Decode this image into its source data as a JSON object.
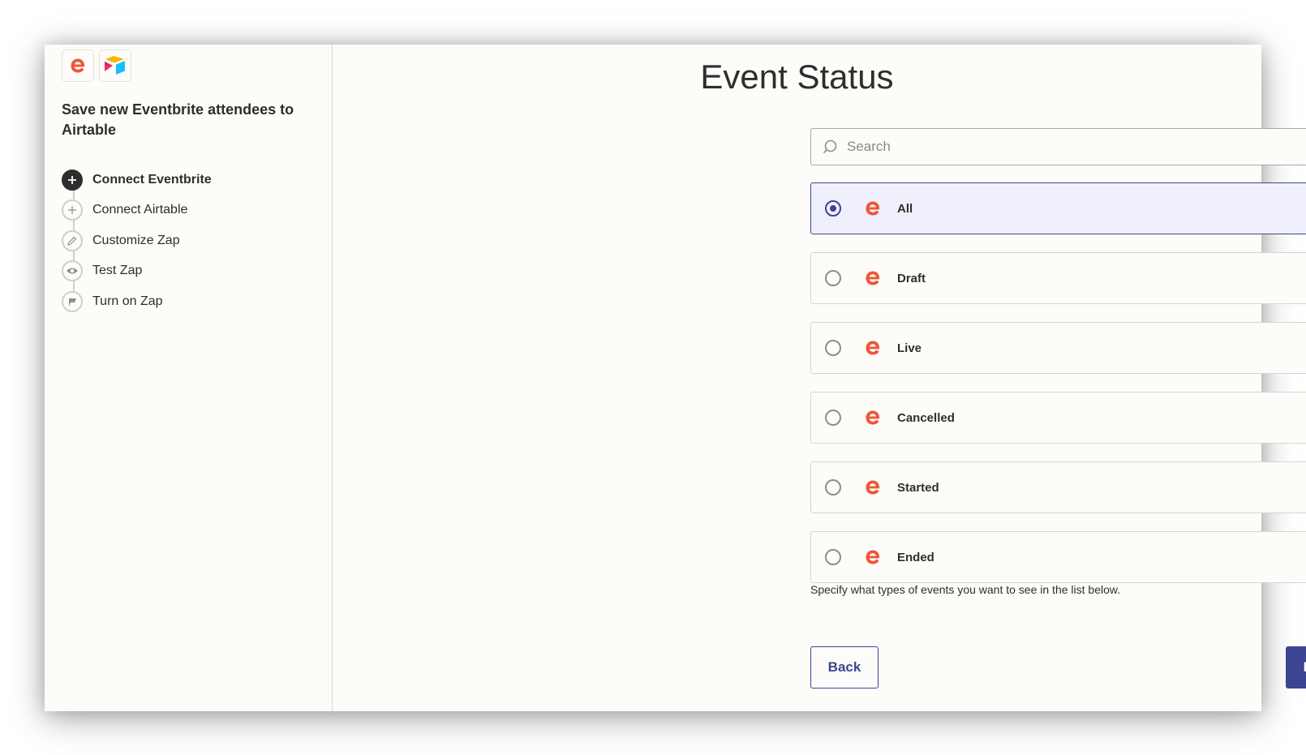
{
  "sidebar": {
    "app_logos": [
      "eventbrite-logo",
      "airtable-logo"
    ],
    "zap_title": "Save new Eventbrite attendees to Airtable",
    "steps": [
      {
        "label": "Connect Eventbrite",
        "icon": "plus-icon",
        "active": true
      },
      {
        "label": "Connect Airtable",
        "icon": "plus-icon",
        "active": false
      },
      {
        "label": "Customize Zap",
        "icon": "pencil-icon",
        "active": false
      },
      {
        "label": "Test Zap",
        "icon": "eye-icon",
        "active": false
      },
      {
        "label": "Turn on Zap",
        "icon": "flag-icon",
        "active": false
      }
    ]
  },
  "main": {
    "title": "Event Status",
    "search": {
      "placeholder": "Search",
      "value": ""
    },
    "options": [
      {
        "label": "All",
        "selected": true
      },
      {
        "label": "Draft",
        "selected": false
      },
      {
        "label": "Live",
        "selected": false
      },
      {
        "label": "Cancelled",
        "selected": false
      },
      {
        "label": "Started",
        "selected": false
      },
      {
        "label": "Ended",
        "selected": false
      }
    ],
    "help_text": "Specify what types of events you want to see in the list below.",
    "back_label": "Back",
    "next_label": "Next"
  },
  "colors": {
    "accent": "#3d4592",
    "eventbrite": "#f05537",
    "selected_bg": "#eff0fb",
    "text": "#2d2e2e"
  }
}
